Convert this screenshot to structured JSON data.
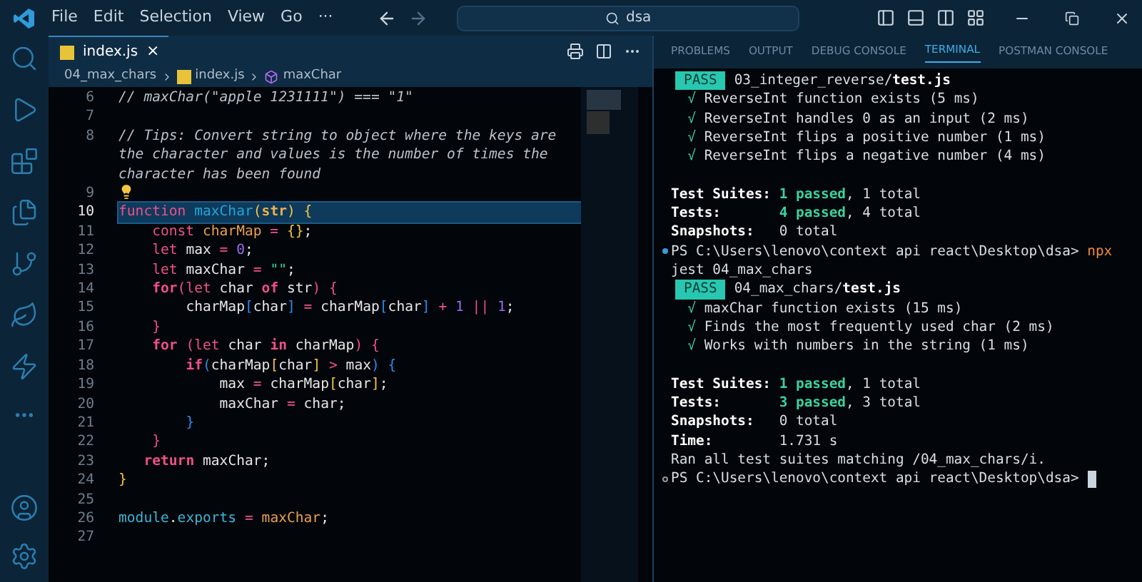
{
  "menu": [
    "File",
    "Edit",
    "Selection",
    "View",
    "Go",
    "···"
  ],
  "search": {
    "value": "dsa"
  },
  "editor": {
    "tab": {
      "label": "index.js",
      "close": "×",
      "selected": true
    },
    "breadcrumb": [
      "04_max_chars",
      "index.js",
      "maxChar"
    ],
    "lines": [
      {
        "number": "6",
        "selected": false,
        "tokens": [
          {
            "kind": "comment",
            "text": "// maxChar(\"apple 1231111\") === \"1\""
          }
        ]
      },
      {
        "number": "7",
        "selected": false
      },
      {
        "number": "8",
        "selected": false,
        "tokens": [
          {
            "kind": "comment",
            "text": "// Tips: Convert string to object where the keys are the character and values is the number of times the character has been found"
          }
        ]
      },
      {
        "number": "9",
        "selected": false,
        "lightbulb": true
      },
      {
        "number": "10",
        "selected": true,
        "tokens": [
          {
            "kind": "keyword",
            "text": "function "
          },
          {
            "kind": "function_name",
            "text": "maxChar"
          },
          {
            "kind": "brace",
            "text": "("
          },
          {
            "kind": "parameter",
            "text": "str"
          },
          {
            "kind": "brace",
            "text": ") {"
          }
        ]
      },
      {
        "number": "11",
        "selected": false,
        "tokens": [
          {
            "kind": "keyword",
            "text": "    const "
          },
          {
            "kind": "variable",
            "text": "charMap"
          },
          {
            "kind": "operator",
            "text": " = "
          },
          {
            "kind": "brace",
            "text": "{}"
          },
          {
            "kind": "plain",
            "text": ";"
          }
        ]
      },
      {
        "number": "12",
        "selected": false,
        "tokens": [
          {
            "kind": "keyword",
            "text": "    let "
          },
          {
            "kind": "plain",
            "text": "max"
          },
          {
            "kind": "operator",
            "text": " = "
          },
          {
            "kind": "number",
            "text": "0"
          },
          {
            "kind": "plain",
            "text": ";"
          }
        ]
      },
      {
        "number": "13",
        "selected": false,
        "tokens": [
          {
            "kind": "keyword",
            "text": "    let "
          },
          {
            "kind": "plain",
            "text": "maxChar"
          },
          {
            "kind": "operator",
            "text": " = "
          },
          {
            "kind": "string",
            "text": "\"\""
          },
          {
            "kind": "plain",
            "text": ";"
          }
        ]
      },
      {
        "number": "14",
        "selected": false,
        "tokens": [
          {
            "kind": "control",
            "text": "    for"
          },
          {
            "kind": "operator",
            "text": "("
          },
          {
            "kind": "keyword",
            "text": "let "
          },
          {
            "kind": "plain",
            "text": "char "
          },
          {
            "kind": "control",
            "text": "of "
          },
          {
            "kind": "plain",
            "text": "str"
          },
          {
            "kind": "operator",
            "text": ") {"
          }
        ]
      },
      {
        "number": "15",
        "selected": false,
        "tokens": [
          {
            "kind": "plain",
            "text": "        charMap"
          },
          {
            "kind": "bracket",
            "text": "["
          },
          {
            "kind": "plain",
            "text": "char"
          },
          {
            "kind": "bracket",
            "text": "]"
          },
          {
            "kind": "operator",
            "text": " = "
          },
          {
            "kind": "plain",
            "text": "charMap"
          },
          {
            "kind": "bracket",
            "text": "["
          },
          {
            "kind": "plain",
            "text": "char"
          },
          {
            "kind": "bracket",
            "text": "]"
          },
          {
            "kind": "operator",
            "text": " + "
          },
          {
            "kind": "number",
            "text": "1 "
          },
          {
            "kind": "operator",
            "text": "|| "
          },
          {
            "kind": "number",
            "text": "1"
          },
          {
            "kind": "plain",
            "text": ";"
          }
        ]
      },
      {
        "number": "16",
        "selected": false,
        "tokens": [
          {
            "kind": "operator",
            "text": "    }"
          }
        ]
      },
      {
        "number": "17",
        "selected": false,
        "tokens": [
          {
            "kind": "control",
            "text": "    for "
          },
          {
            "kind": "operator",
            "text": "("
          },
          {
            "kind": "keyword",
            "text": "let "
          },
          {
            "kind": "plain",
            "text": "char "
          },
          {
            "kind": "control",
            "text": "in "
          },
          {
            "kind": "plain",
            "text": "charMap"
          },
          {
            "kind": "operator",
            "text": ") {"
          }
        ]
      },
      {
        "number": "18",
        "selected": false,
        "tokens": [
          {
            "kind": "control",
            "text": "        if"
          },
          {
            "kind": "bracket",
            "text": "("
          },
          {
            "kind": "plain",
            "text": "charMap"
          },
          {
            "kind": "brace",
            "text": "["
          },
          {
            "kind": "plain",
            "text": "char"
          },
          {
            "kind": "brace",
            "text": "]"
          },
          {
            "kind": "operator",
            "text": " > "
          },
          {
            "kind": "plain",
            "text": "max"
          },
          {
            "kind": "bracket",
            "text": ") {"
          }
        ]
      },
      {
        "number": "19",
        "selected": false,
        "tokens": [
          {
            "kind": "plain",
            "text": "            max"
          },
          {
            "kind": "operator",
            "text": " = "
          },
          {
            "kind": "plain",
            "text": "charMap"
          },
          {
            "kind": "brace",
            "text": "["
          },
          {
            "kind": "plain",
            "text": "char"
          },
          {
            "kind": "brace",
            "text": "]"
          },
          {
            "kind": "plain",
            "text": ";"
          }
        ]
      },
      {
        "number": "20",
        "selected": false,
        "tokens": [
          {
            "kind": "plain",
            "text": "            maxChar"
          },
          {
            "kind": "operator",
            "text": " = "
          },
          {
            "kind": "plain",
            "text": "char;"
          }
        ]
      },
      {
        "number": "21",
        "selected": false,
        "tokens": [
          {
            "kind": "bracket",
            "text": "        }"
          }
        ]
      },
      {
        "number": "22",
        "selected": false,
        "tokens": [
          {
            "kind": "operator",
            "text": "    }"
          }
        ]
      },
      {
        "number": "23",
        "selected": false,
        "tokens": [
          {
            "kind": "control",
            "text": "   return "
          },
          {
            "kind": "plain",
            "text": "maxChar;"
          }
        ]
      },
      {
        "number": "24",
        "selected": false,
        "tokens": [
          {
            "kind": "brace",
            "text": "}"
          }
        ]
      },
      {
        "number": "25",
        "selected": false
      },
      {
        "number": "26",
        "selected": false,
        "tokens": [
          {
            "kind": "property",
            "text": "module"
          },
          {
            "kind": "plain",
            "text": "."
          },
          {
            "kind": "property",
            "text": "exports"
          },
          {
            "kind": "operator",
            "text": " = "
          },
          {
            "kind": "variable",
            "text": "maxChar"
          },
          {
            "kind": "plain",
            "text": ";"
          }
        ]
      },
      {
        "number": "27",
        "selected": false
      }
    ]
  },
  "panel": {
    "tabs": [
      {
        "label": "PROBLEMS",
        "selected": false
      },
      {
        "label": "OUTPUT",
        "selected": false
      },
      {
        "label": "DEBUG CONSOLE",
        "selected": false
      },
      {
        "label": "TERMINAL",
        "selected": true
      },
      {
        "label": "POSTMAN CONSOLE",
        "selected": false
      }
    ],
    "terminal": [
      {
        "kind": "pass",
        "badge": "PASS",
        "tokens": [
          {
            "kind": "text",
            "text": "03_integer_reverse/"
          },
          {
            "kind": "bold",
            "text": "test.js"
          }
        ]
      },
      {
        "kind": "line",
        "tokens": [
          {
            "kind": "check",
            "text": "  √ "
          },
          {
            "kind": "text",
            "text": "ReverseInt function exists (5 ms)"
          }
        ]
      },
      {
        "kind": "line",
        "tokens": [
          {
            "kind": "check",
            "text": "  √ "
          },
          {
            "kind": "text",
            "text": "ReverseInt handles 0 as an input (2 ms)"
          }
        ]
      },
      {
        "kind": "line",
        "tokens": [
          {
            "kind": "check",
            "text": "  √ "
          },
          {
            "kind": "text",
            "text": "ReverseInt flips a positive number (1 ms)"
          }
        ]
      },
      {
        "kind": "line",
        "tokens": [
          {
            "kind": "check",
            "text": "  √ "
          },
          {
            "kind": "text",
            "text": "ReverseInt flips a negative number (4 ms)"
          }
        ]
      },
      {
        "kind": "blank"
      },
      {
        "kind": "line",
        "tokens": [
          {
            "kind": "bold",
            "text": "Test Suites: "
          },
          {
            "kind": "passed",
            "text": "1 passed"
          },
          {
            "kind": "text",
            "text": ", 1 total"
          }
        ]
      },
      {
        "kind": "line",
        "tokens": [
          {
            "kind": "bold",
            "text": "Tests:       "
          },
          {
            "kind": "passed",
            "text": "4 passed"
          },
          {
            "kind": "text",
            "text": ", 4 total"
          }
        ]
      },
      {
        "kind": "line",
        "tokens": [
          {
            "kind": "bold",
            "text": "Snapshots:   "
          },
          {
            "kind": "text",
            "text": "0 total"
          }
        ]
      },
      {
        "kind": "prompt",
        "success": true,
        "tokens": [
          {
            "kind": "text",
            "text": "PS C:\\Users\\lenovo\\context api react\\Desktop\\dsa> "
          },
          {
            "kind": "command",
            "text": "npx"
          }
        ]
      },
      {
        "kind": "line",
        "tokens": [
          {
            "kind": "text",
            "text": "jest 04_max_chars"
          }
        ]
      },
      {
        "kind": "pass",
        "badge": "PASS",
        "tokens": [
          {
            "kind": "text",
            "text": "04_max_chars/"
          },
          {
            "kind": "bold",
            "text": "test.js"
          }
        ]
      },
      {
        "kind": "line",
        "tokens": [
          {
            "kind": "check",
            "text": "  √ "
          },
          {
            "kind": "text",
            "text": "maxChar function exists (15 ms)"
          }
        ]
      },
      {
        "kind": "line",
        "tokens": [
          {
            "kind": "check",
            "text": "  √ "
          },
          {
            "kind": "text",
            "text": "Finds the most frequently used char (2 ms)"
          }
        ]
      },
      {
        "kind": "line",
        "tokens": [
          {
            "kind": "check",
            "text": "  √ "
          },
          {
            "kind": "text",
            "text": "Works with numbers in the string (1 ms)"
          }
        ]
      },
      {
        "kind": "blank"
      },
      {
        "kind": "line",
        "tokens": [
          {
            "kind": "bold",
            "text": "Test Suites: "
          },
          {
            "kind": "passed",
            "text": "1 passed"
          },
          {
            "kind": "text",
            "text": ", 1 total"
          }
        ]
      },
      {
        "kind": "line",
        "tokens": [
          {
            "kind": "bold",
            "text": "Tests:       "
          },
          {
            "kind": "passed",
            "text": "3 passed"
          },
          {
            "kind": "text",
            "text": ", 3 total"
          }
        ]
      },
      {
        "kind": "line",
        "tokens": [
          {
            "kind": "bold",
            "text": "Snapshots:   "
          },
          {
            "kind": "text",
            "text": "0 total"
          }
        ]
      },
      {
        "kind": "line",
        "tokens": [
          {
            "kind": "bold",
            "text": "Time:        "
          },
          {
            "kind": "text",
            "text": "1.731 s"
          }
        ]
      },
      {
        "kind": "line",
        "tokens": [
          {
            "kind": "text",
            "text": "Ran all test suites matching /04_max_chars/i."
          }
        ]
      },
      {
        "kind": "prompt",
        "success": false,
        "cursor": true,
        "tokens": [
          {
            "kind": "text",
            "text": "PS C:\\Users\\lenovo\\context api react\\Desktop\\dsa> "
          }
        ]
      }
    ]
  }
}
